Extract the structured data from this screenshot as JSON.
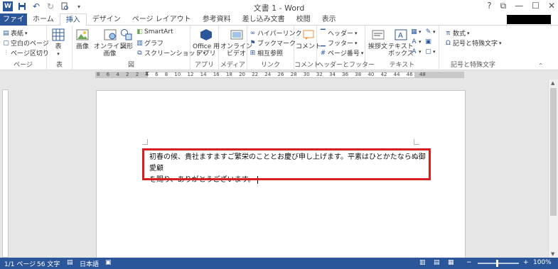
{
  "window": {
    "title": "文書 1 - Word",
    "help": "?",
    "restore_ribbon": "⧉",
    "minimize": "—",
    "maximize": "☐",
    "close": "✕"
  },
  "tabs": {
    "file": "ファイル",
    "items": [
      "ホーム",
      "挿入",
      "デザイン",
      "ページ レイアウト",
      "参考資料",
      "差し込み文書",
      "校閲",
      "表示"
    ],
    "active": "挿入"
  },
  "ribbon": {
    "page_group": {
      "label": "ページ",
      "cover": "表紙",
      "blank": "空白のページ",
      "break": "ページ区切り"
    },
    "table_group": {
      "label": "表",
      "table": "表"
    },
    "illustrations_group": {
      "label": "図",
      "picture": "画像",
      "online_picture_1": "オンライン",
      "online_picture_2": "画像",
      "shapes": "図形",
      "smartart": "SmartArt",
      "chart": "グラフ",
      "screenshot": "スクリーンショット"
    },
    "apps_group": {
      "label": "アプリ",
      "office_1": "Office 用",
      "office_2": "アプリ"
    },
    "media_group": {
      "label": "メディア",
      "video_1": "オンライン",
      "video_2": "ビデオ"
    },
    "links_group": {
      "label": "リンク",
      "hyperlink": "ハイパーリンク",
      "bookmark": "ブックマーク",
      "crossref": "相互参照"
    },
    "comments_group": {
      "label": "コメント",
      "comment": "コメント"
    },
    "header_footer_group": {
      "label": "ヘッダーとフッター",
      "header": "ヘッダー",
      "footer": "フッター",
      "page_number": "ページ番号"
    },
    "text_group": {
      "label": "テキスト",
      "greeting": "挨拶文",
      "textbox_1": "テキスト",
      "textbox_2": "ボックス"
    },
    "symbols_group": {
      "label": "記号と特殊文字",
      "equation": "数式",
      "symbol": "記号と特殊文字"
    }
  },
  "ruler": {
    "numbers": "8 6 4 2 2 4 6 8 10 12 14 16 18 20 22 24 26 28 30 32 34 36 38 40 42 44 46 48"
  },
  "document": {
    "line1": "初春の候、貴社ますますご繁栄のこととお慶び申し上げます。平素はひとかたならぬ御愛顧",
    "line2": "を賜り、ありがとうございます。"
  },
  "status": {
    "page": "1/1 ページ",
    "words": "56 文字",
    "language": "日本語",
    "zoom": "100%",
    "zoom_level": 100
  },
  "colors": {
    "accent": "#2b579a",
    "highlight_box": "#d81e1e"
  }
}
